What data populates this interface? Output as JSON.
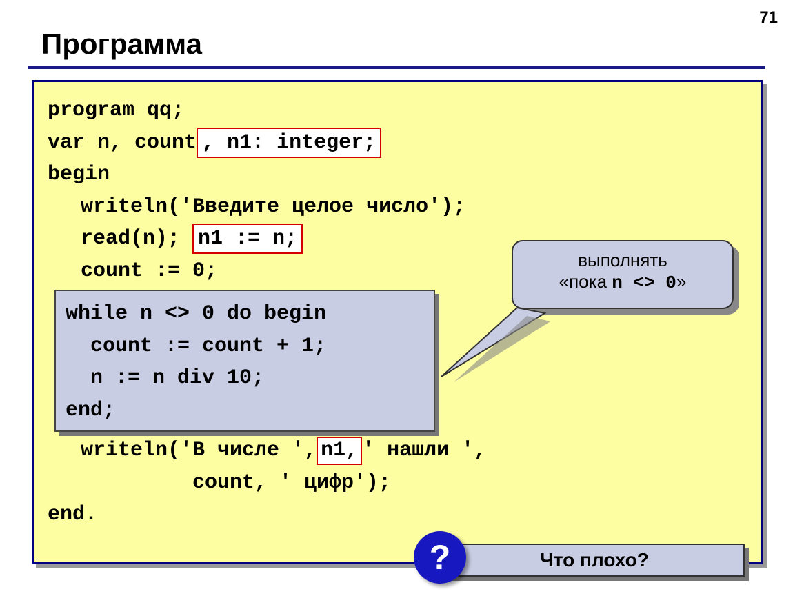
{
  "pageNumber": "71",
  "title": "Программа",
  "code": {
    "l1": "program qq;",
    "l2a": "var n, count",
    "l2box": ", n1: integer;",
    "l3": "begin",
    "l4": "writeln('Введите целое число');",
    "l5a": "read(n); ",
    "l5box": "n1 := n;",
    "l6": "count := 0;",
    "while": {
      "w1": "while n <> 0 do begin",
      "w2": "  count := count + 1;",
      "w3": "  n := n div 10;",
      "w4": "end;"
    },
    "l8a": "writeln('В числе ',",
    "l8box": "n1,",
    "l8b": "' нашли ',",
    "l9": "count, ' цифр');",
    "l10": "end."
  },
  "callout": {
    "line1": "выполнять",
    "line2a": "«пока ",
    "line2b": "n <> 0",
    "line2c": "»"
  },
  "question": {
    "mark": "?",
    "text": "Что плохо?"
  }
}
